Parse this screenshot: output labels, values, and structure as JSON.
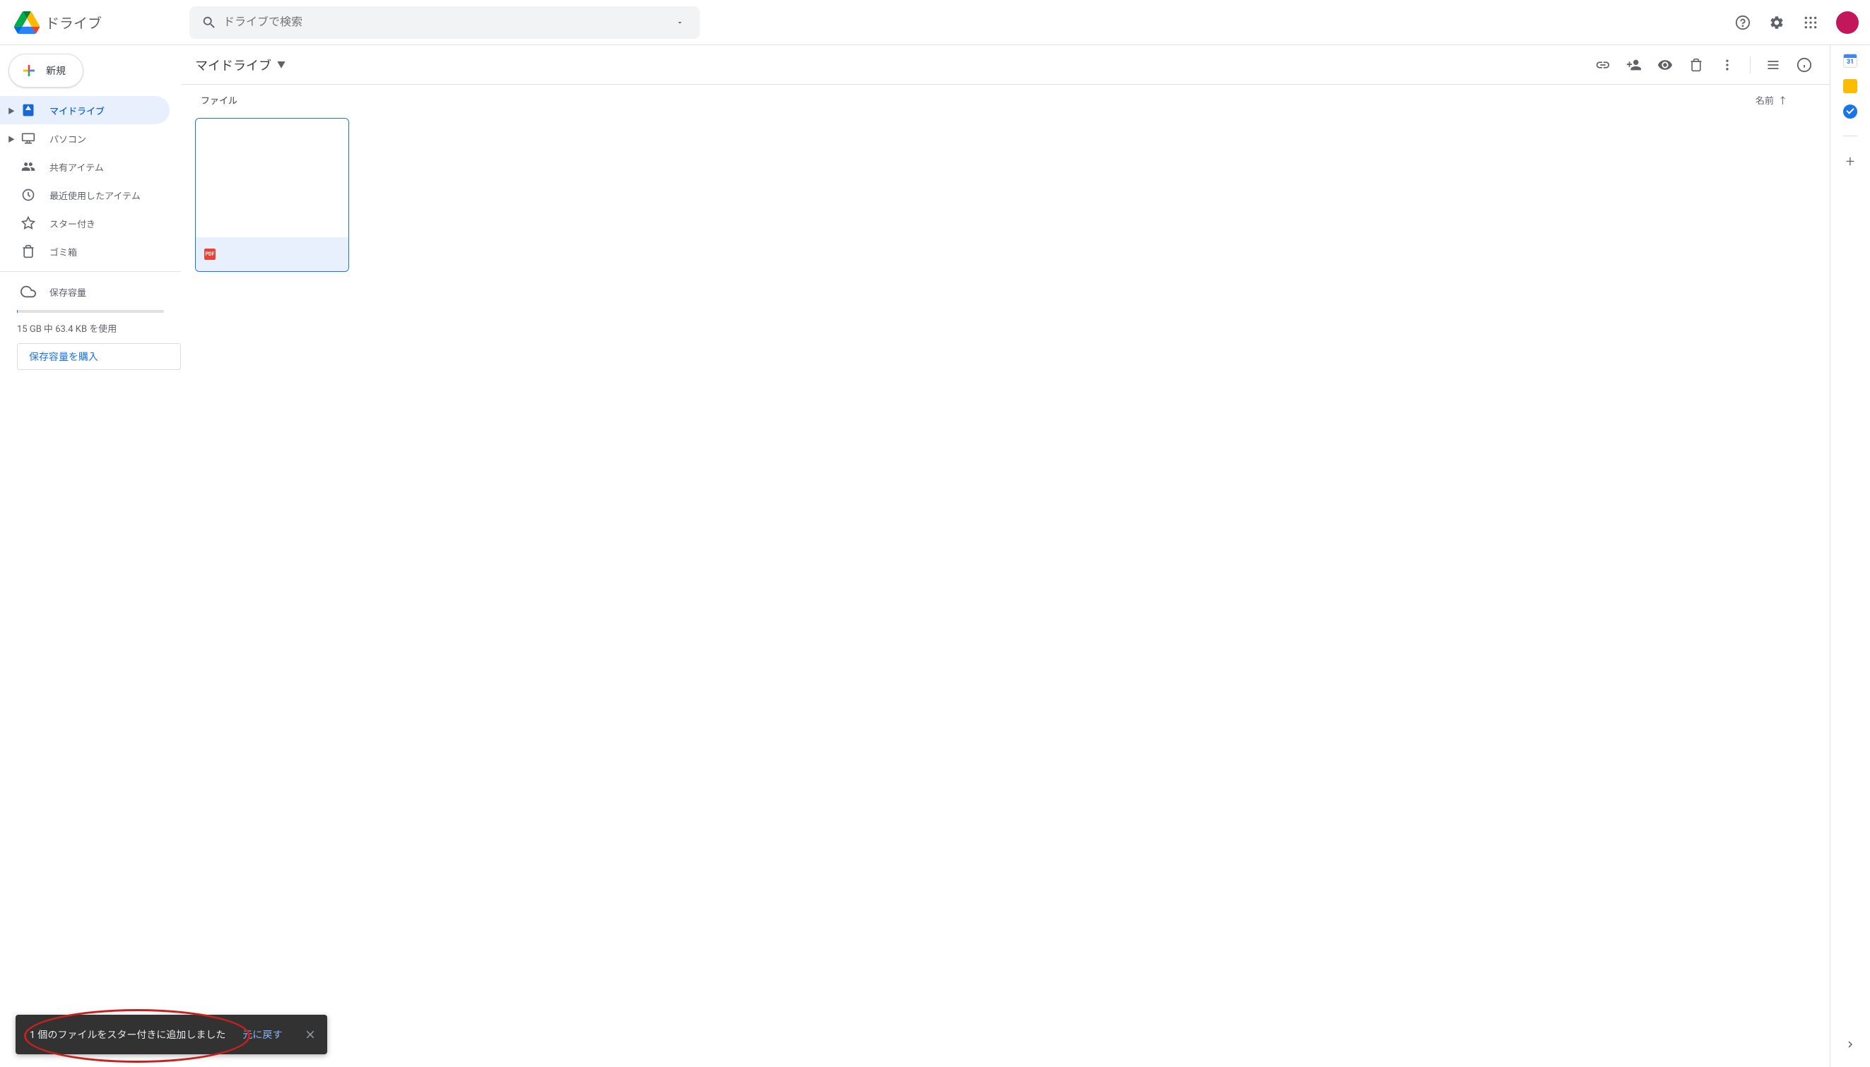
{
  "app": {
    "name": "ドライブ"
  },
  "search": {
    "placeholder": "ドライブで検索"
  },
  "sidebar": {
    "new_label": "新規",
    "items": [
      {
        "label": "マイドライブ"
      },
      {
        "label": "パソコン"
      },
      {
        "label": "共有アイテム"
      },
      {
        "label": "最近使用したアイテム"
      },
      {
        "label": "スター付き"
      },
      {
        "label": "ゴミ箱"
      }
    ],
    "storage_label": "保存容量",
    "storage_text": "15 GB 中 63.4 KB を使用",
    "buy_label": "保存容量を購入"
  },
  "main": {
    "breadcrumb": "マイドライブ",
    "section_label": "ファイル",
    "sort_label": "名前"
  },
  "files": [
    {
      "type": "PDF"
    }
  ],
  "rail": {
    "calendar_day": "31"
  },
  "toast": {
    "message": "1 個のファイルをスター付きに追加しました",
    "undo": "元に戻す"
  }
}
